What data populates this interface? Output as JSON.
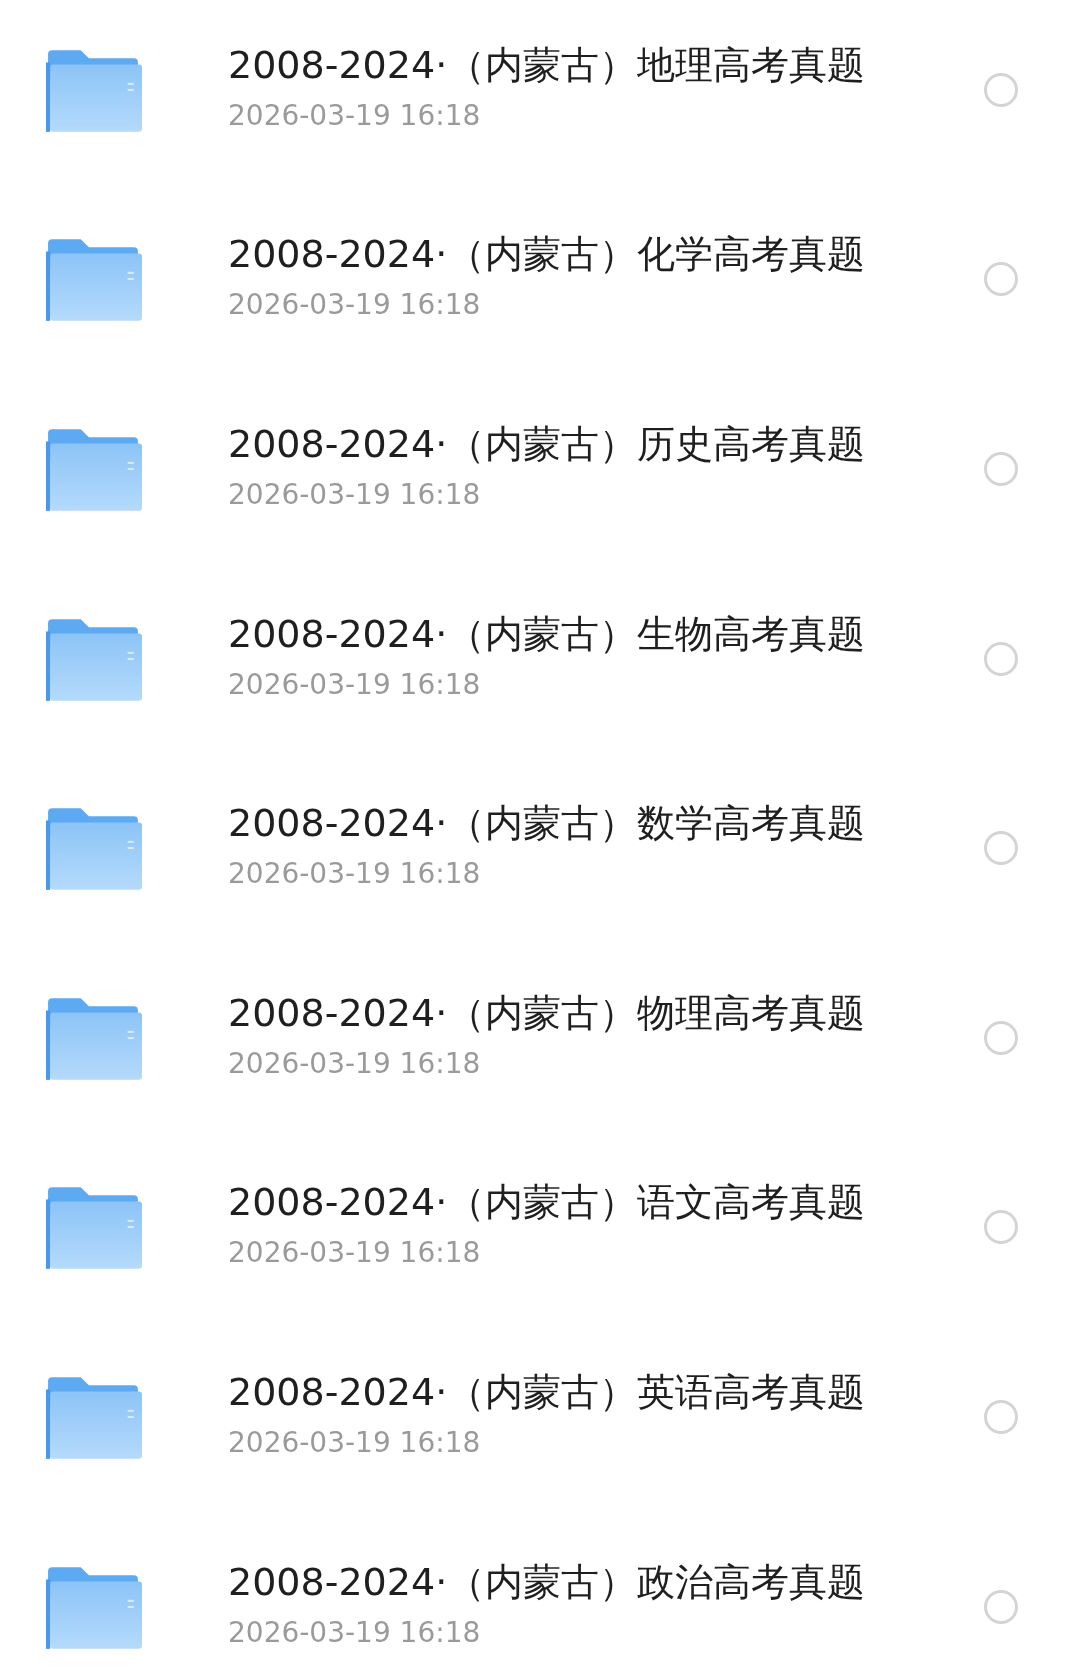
{
  "files": [
    {
      "name": "2008-2024·（内蒙古）地理高考真题",
      "date": "2026-03-19 16:18",
      "selected": false
    },
    {
      "name": "2008-2024·（内蒙古）化学高考真题",
      "date": "2026-03-19 16:18",
      "selected": false
    },
    {
      "name": "2008-2024·（内蒙古）历史高考真题",
      "date": "2026-03-19 16:18",
      "selected": false
    },
    {
      "name": "2008-2024·（内蒙古）生物高考真题",
      "date": "2026-03-19 16:18",
      "selected": false
    },
    {
      "name": "2008-2024·（内蒙古）数学高考真题",
      "date": "2026-03-19 16:18",
      "selected": false
    },
    {
      "name": "2008-2024·（内蒙古）物理高考真题",
      "date": "2026-03-19 16:18",
      "selected": false
    },
    {
      "name": "2008-2024·（内蒙古）语文高考真题",
      "date": "2026-03-19 16:18",
      "selected": false
    },
    {
      "name": "2008-2024·（内蒙古）英语高考真题",
      "date": "2026-03-19 16:18",
      "selected": false
    },
    {
      "name": "2008-2024·（内蒙古）政治高考真题",
      "date": "2026-03-19 16:18",
      "selected": false
    }
  ]
}
